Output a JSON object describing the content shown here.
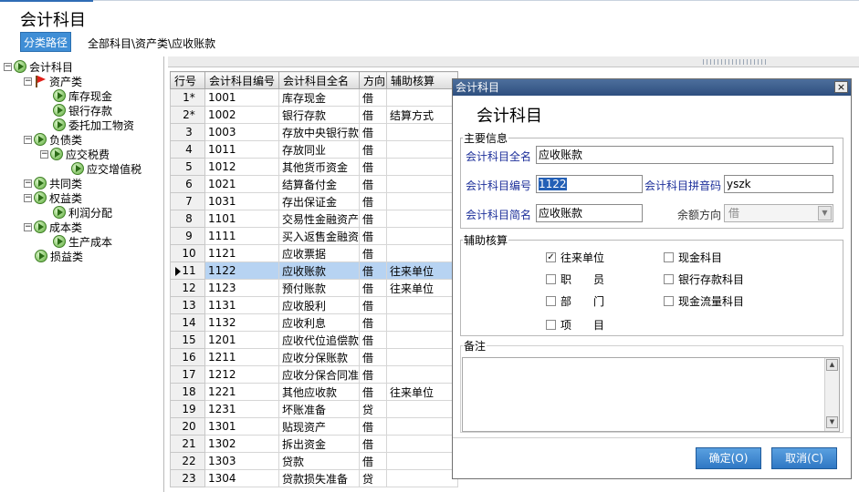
{
  "header": {
    "title": "会计科目",
    "category_path_button": "分类路径",
    "breadcrumb": "全部科目\\资产类\\应收账款"
  },
  "tree": {
    "root": "会计科目",
    "nodes": [
      {
        "label": "资产类",
        "expander": "⊟",
        "icon": "flag-icon"
      },
      {
        "label": "库存现金",
        "icon": "play-circle-icon"
      },
      {
        "label": "银行存款",
        "icon": "play-circle-icon"
      },
      {
        "label": "委托加工物资",
        "icon": "play-circle-icon"
      },
      {
        "label": "负债类",
        "expander": "⊟",
        "icon": "play-circle-icon"
      },
      {
        "label": "应交税费",
        "expander": "⊟",
        "icon": "play-circle-icon"
      },
      {
        "label": "应交增值税",
        "icon": "play-circle-icon"
      },
      {
        "label": "共同类",
        "expander": "⊟",
        "icon": "play-circle-icon"
      },
      {
        "label": "权益类",
        "expander": "⊟",
        "icon": "play-circle-icon"
      },
      {
        "label": "利润分配",
        "icon": "play-circle-icon"
      },
      {
        "label": "成本类",
        "expander": "⊟",
        "icon": "play-circle-icon"
      },
      {
        "label": "生产成本",
        "icon": "play-circle-icon"
      },
      {
        "label": "损益类",
        "icon": "play-circle-icon"
      }
    ]
  },
  "grid": {
    "headers": [
      "行号",
      "会计科目编号",
      "会计科目全名",
      "方向",
      "辅助核算"
    ],
    "selected_row": 11,
    "rows": [
      {
        "no": "1*",
        "code": "1001",
        "name": "库存现金",
        "dir": "借",
        "aux": ""
      },
      {
        "no": "2*",
        "code": "1002",
        "name": "银行存款",
        "dir": "借",
        "aux": "结算方式"
      },
      {
        "no": "3",
        "code": "1003",
        "name": "存放中央银行款",
        "dir": "借",
        "aux": ""
      },
      {
        "no": "4",
        "code": "1011",
        "name": "存放同业",
        "dir": "借",
        "aux": ""
      },
      {
        "no": "5",
        "code": "1012",
        "name": "其他货币资金",
        "dir": "借",
        "aux": ""
      },
      {
        "no": "6",
        "code": "1021",
        "name": "结算备付金",
        "dir": "借",
        "aux": ""
      },
      {
        "no": "7",
        "code": "1031",
        "name": "存出保证金",
        "dir": "借",
        "aux": ""
      },
      {
        "no": "8",
        "code": "1101",
        "name": "交易性金融资产",
        "dir": "借",
        "aux": ""
      },
      {
        "no": "9",
        "code": "1111",
        "name": "买入返售金融资",
        "dir": "借",
        "aux": ""
      },
      {
        "no": "10",
        "code": "1121",
        "name": "应收票据",
        "dir": "借",
        "aux": ""
      },
      {
        "no": "11",
        "code": "1122",
        "name": "应收账款",
        "dir": "借",
        "aux": "往来单位"
      },
      {
        "no": "12",
        "code": "1123",
        "name": "预付账款",
        "dir": "借",
        "aux": "往来单位"
      },
      {
        "no": "13",
        "code": "1131",
        "name": "应收股利",
        "dir": "借",
        "aux": ""
      },
      {
        "no": "14",
        "code": "1132",
        "name": "应收利息",
        "dir": "借",
        "aux": ""
      },
      {
        "no": "15",
        "code": "1201",
        "name": "应收代位追偿款",
        "dir": "借",
        "aux": ""
      },
      {
        "no": "16",
        "code": "1211",
        "name": "应收分保账款",
        "dir": "借",
        "aux": ""
      },
      {
        "no": "17",
        "code": "1212",
        "name": "应收分保合同准",
        "dir": "借",
        "aux": ""
      },
      {
        "no": "18",
        "code": "1221",
        "name": "其他应收款",
        "dir": "借",
        "aux": "往来单位"
      },
      {
        "no": "19",
        "code": "1231",
        "name": "坏账准备",
        "dir": "贷",
        "aux": ""
      },
      {
        "no": "20",
        "code": "1301",
        "name": "贴现资产",
        "dir": "借",
        "aux": ""
      },
      {
        "no": "21",
        "code": "1302",
        "name": "拆出资金",
        "dir": "借",
        "aux": ""
      },
      {
        "no": "22",
        "code": "1303",
        "name": "贷款",
        "dir": "借",
        "aux": ""
      },
      {
        "no": "23",
        "code": "1304",
        "name": "贷款损失准备",
        "dir": "贷",
        "aux": ""
      }
    ]
  },
  "dialog": {
    "window_title": "会计科目",
    "heading": "会计科目",
    "main_info_legend": "主要信息",
    "full_name_label": "会计科目全名",
    "full_name_value": "应收账款",
    "code_label": "会计科目编号",
    "code_value": "1122",
    "pinyin_label": "会计科目拼音码",
    "pinyin_value": "yszk",
    "short_name_label": "会计科目简名",
    "short_name_value": "应收账款",
    "balance_dir_label": "余额方向",
    "balance_dir_value": "借",
    "aux_legend": "辅助核算",
    "checkboxes": [
      {
        "label": "往来单位",
        "checked": true
      },
      {
        "label": "职　　员",
        "checked": false
      },
      {
        "label": "部　　门",
        "checked": false
      },
      {
        "label": "项　　目",
        "checked": false
      },
      {
        "label": "现金科目",
        "checked": false
      },
      {
        "label": "银行存款科目",
        "checked": false
      },
      {
        "label": "现金流量科目",
        "checked": false
      }
    ],
    "memo_legend": "备注",
    "memo_value": "",
    "ok_button": "确定(O)",
    "cancel_button": "取消(C)",
    "close_glyph": "×"
  },
  "colors": {
    "accent": "#3f8ed6",
    "selection": "#b7d3f2",
    "field_label": "#1c2f9a",
    "annotation_circle": "#e05050"
  }
}
